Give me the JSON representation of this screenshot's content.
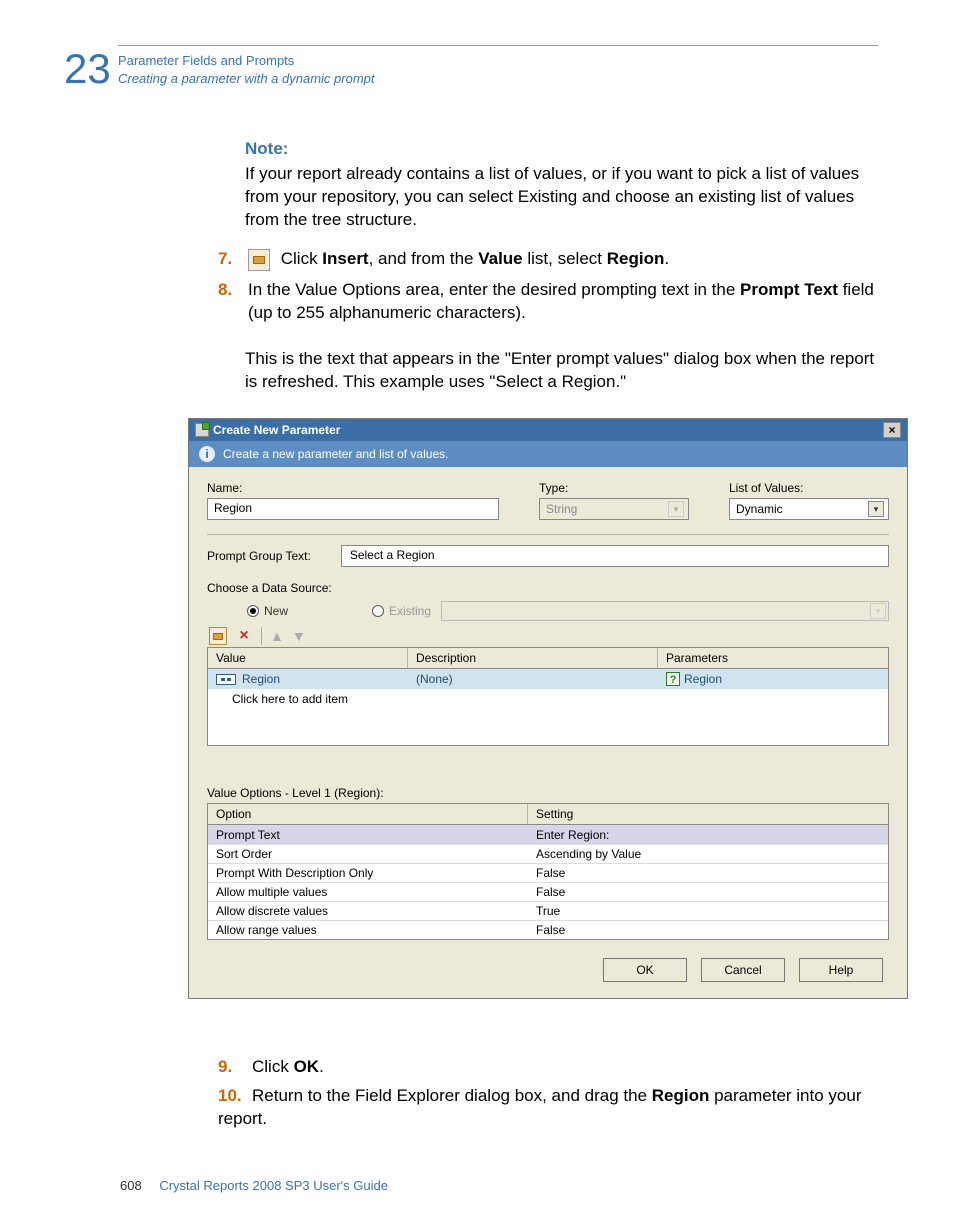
{
  "header": {
    "chapter_num": "23",
    "line1": "Parameter Fields and Prompts",
    "line2": "Creating a parameter with a dynamic prompt"
  },
  "note": {
    "label": "Note:",
    "body": "If your report already contains a list of values, or if you want to pick a list of values from your repository, you can select Existing and choose an existing list of values from the tree structure."
  },
  "steps": {
    "s7": {
      "num": "7.",
      "pre": " Click ",
      "insert": "Insert",
      "mid": ", and from the ",
      "value": "Value",
      "mid2": " list, select ",
      "region": "Region",
      "post": "."
    },
    "s8": {
      "num": "8.",
      "body_pre": "In the Value Options area, enter the desired prompting text in the ",
      "prompt_text": "Prompt Text",
      "body_post": " field (up to 255 alphanumeric characters)."
    }
  },
  "post_note": "This is the text that appears in the \"Enter prompt values\" dialog box when the report is refreshed. This example uses \"Select a Region.\"",
  "dialog": {
    "title": "Create New Parameter",
    "close_x": "×",
    "info": "Create a new parameter and list of values.",
    "name_label": "Name:",
    "name_value": "Region",
    "type_label": "Type:",
    "type_value": "String",
    "lov_label": "List of Values:",
    "lov_value": "Dynamic",
    "pgt_label": "Prompt Group Text:",
    "pgt_value": "Select a Region",
    "ds_label": "Choose a Data Source:",
    "ds_new": "New",
    "ds_existing": "Existing",
    "toolbar_x": "×",
    "vtable": {
      "h1": "Value",
      "h2": "Description",
      "h3": "Parameters",
      "r1_value": "Region",
      "r1_desc": "(None)",
      "r1_param": "Region",
      "r2_value": "Click here to add item"
    },
    "vo_title": "Value Options - Level 1 (Region):",
    "vo": {
      "h_option": "Option",
      "h_setting": "Setting",
      "rows": [
        {
          "o": "Prompt Text",
          "s": "Enter Region:"
        },
        {
          "o": "Sort Order",
          "s": "Ascending by Value"
        },
        {
          "o": "Prompt With Description Only",
          "s": "False"
        },
        {
          "o": "Allow multiple values",
          "s": "False"
        },
        {
          "o": "Allow discrete values",
          "s": "True"
        },
        {
          "o": "Allow range values",
          "s": "False"
        }
      ]
    },
    "btn_ok": "OK",
    "btn_cancel": "Cancel",
    "btn_help": "Help"
  },
  "tail": {
    "s9_num": "9.",
    "s9_pre": "Click ",
    "s9_ok": "OK",
    "s9_post": ".",
    "s10_num": "10.",
    "s10_pre": "Return to the Field Explorer dialog box, and drag the ",
    "s10_region": "Region",
    "s10_post": " parameter into your report."
  },
  "footer": {
    "page": "608",
    "title": "Crystal Reports 2008 SP3 User's Guide"
  }
}
